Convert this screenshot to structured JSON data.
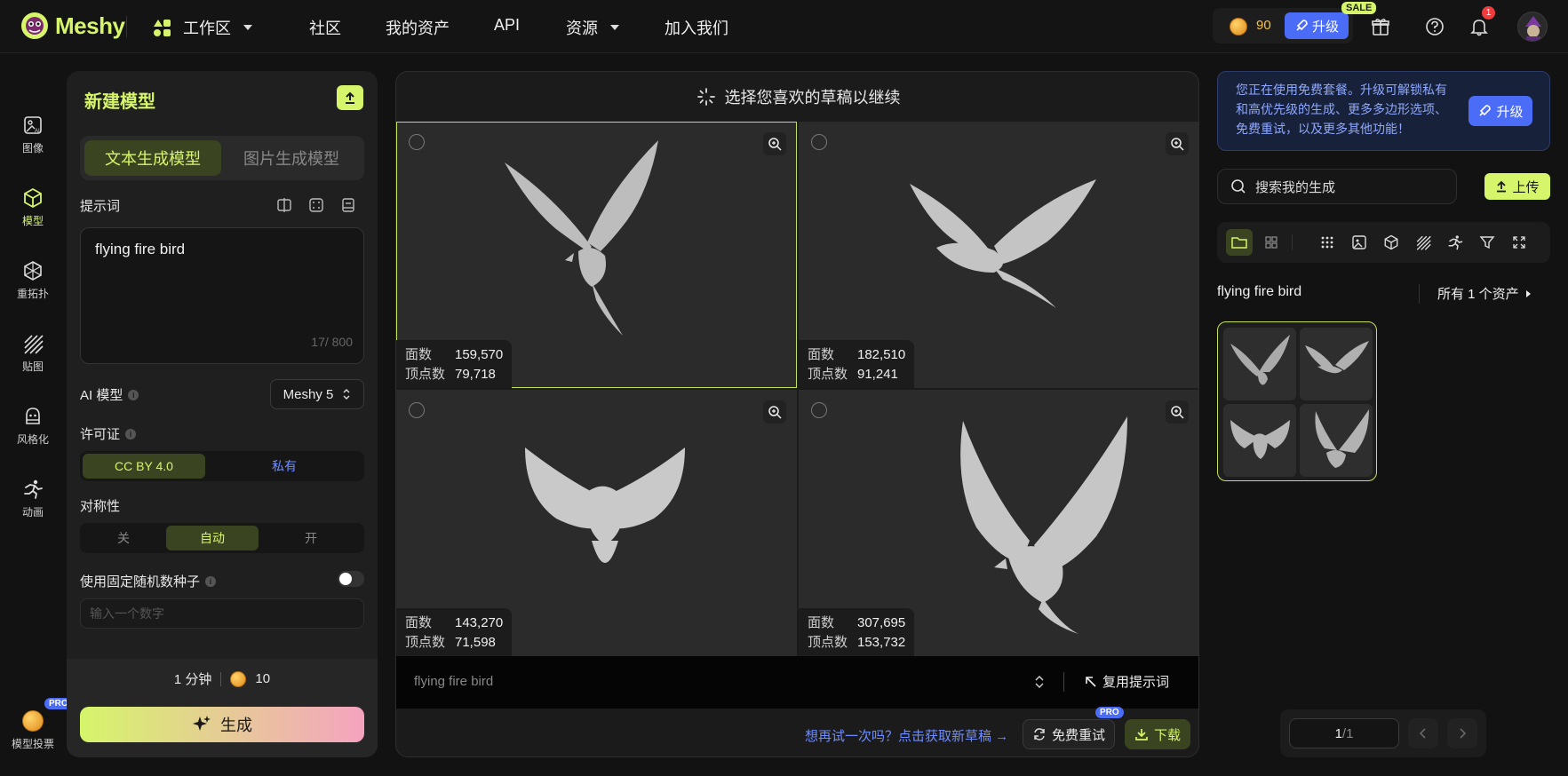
{
  "nav": {
    "brand": "Meshy",
    "workspace": "工作区",
    "items": [
      "社区",
      "我的资产",
      "API",
      "资源",
      "加入我们"
    ],
    "credits": "90",
    "upgrade": "升级",
    "sale": "SALE",
    "notifications": "1"
  },
  "rail": {
    "items": [
      "图像",
      "模型",
      "重拓扑",
      "贴图",
      "风格化",
      "动画"
    ],
    "vote": "模型投票",
    "pro": "PRO"
  },
  "left": {
    "title": "新建模型",
    "tabs": [
      "文本生成模型",
      "图片生成模型"
    ],
    "prompt_label": "提示词",
    "prompt_value": "flying fire bird",
    "prompt_counter": "17/ 800",
    "ai_model_label": "AI 模型",
    "ai_model_value": "Meshy 5",
    "license_label": "许可证",
    "license_options": [
      "CC BY 4.0",
      "私有"
    ],
    "symmetry_label": "对称性",
    "symmetry_options": [
      "关",
      "自动",
      "开"
    ],
    "seed_label": "使用固定随机数种子",
    "seed_placeholder": "输入一个数字",
    "time": "1 分钟",
    "cost": "10",
    "generate": "生成",
    "info": "i"
  },
  "center": {
    "header": "选择您喜欢的草稿以继续",
    "face_label": "面数",
    "vertex_label": "顶点数",
    "drafts": [
      {
        "faces": "159,570",
        "vertices": "79,718"
      },
      {
        "faces": "182,510",
        "vertices": "91,241"
      },
      {
        "faces": "143,270",
        "vertices": "71,598"
      },
      {
        "faces": "307,695",
        "vertices": "153,732"
      }
    ],
    "prompt": "flying fire bird",
    "reuse": "复用提示词",
    "retry_link": "想再试一次吗？点击获取新草稿 →",
    "free_retry": "免费重试",
    "pro": "PRO",
    "download": "下载"
  },
  "right": {
    "promo": "您正在使用免费套餐。升级可解锁私有和高优先级的生成、更多多边形选项、免费重试，以及更多其他功能！",
    "promo_btn": "升级",
    "search_placeholder": "搜索我的生成",
    "upload": "上传",
    "gallery_title": "flying fire bird",
    "gallery_all": "所有 1 个资产",
    "page_current": "1",
    "page_total": "/1"
  },
  "colors": {
    "accent": "#d6f56a",
    "blue": "#4a6cf7",
    "link": "#6f8cff"
  },
  "icons": [
    "logo-icon",
    "workspace-icon",
    "coin-icon",
    "rocket-icon",
    "gift-icon",
    "help-icon",
    "bell-icon",
    "image-ai-icon",
    "cube-icon",
    "retopology-icon",
    "texture-icon",
    "stylize-icon",
    "animation-icon",
    "upload-icon",
    "sparkle-icon",
    "zoom-icon",
    "search-icon",
    "folder-icon",
    "grid-icon",
    "filter-icon",
    "expand-icon",
    "chevron-left-icon",
    "chevron-right-icon",
    "download-icon",
    "refresh-icon"
  ]
}
